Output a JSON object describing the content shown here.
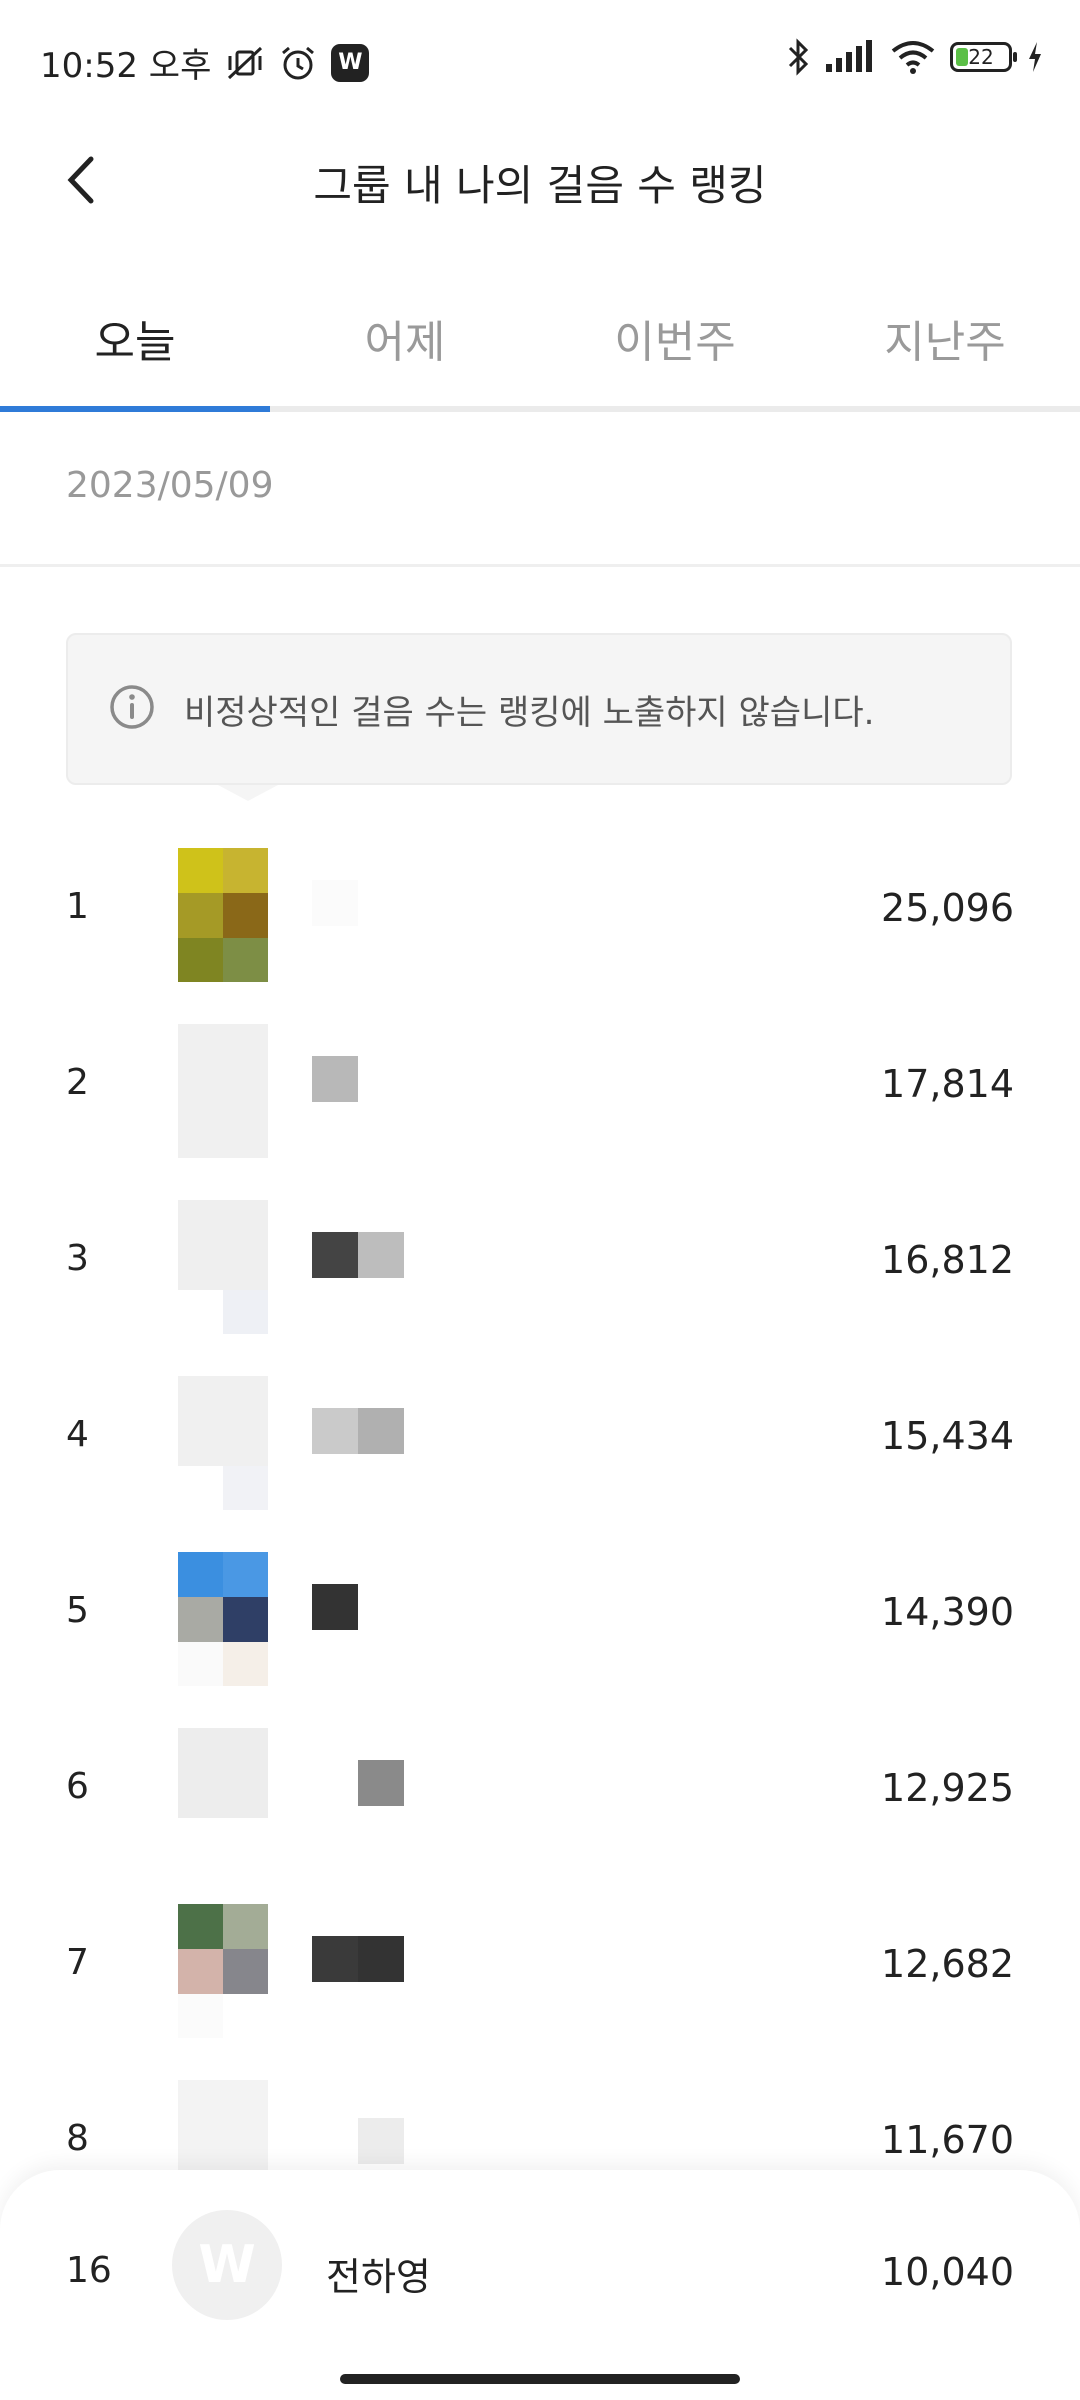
{
  "status_bar": {
    "time": "10:52 오후",
    "app_badge": "W",
    "battery": "22"
  },
  "header": {
    "title": "그룹 내 나의 걸음 수 랭킹"
  },
  "tabs": [
    {
      "label": "오늘",
      "active": true
    },
    {
      "label": "어제",
      "active": false
    },
    {
      "label": "이번주",
      "active": false
    },
    {
      "label": "지난주",
      "active": false
    }
  ],
  "date": "2023/05/09",
  "notice": {
    "text": "비정상적인 걸음 수는 랭킹에 노출하지 않습니다."
  },
  "rankings": [
    {
      "rank": "1",
      "steps": "25,096"
    },
    {
      "rank": "2",
      "steps": "17,814"
    },
    {
      "rank": "3",
      "steps": "16,812"
    },
    {
      "rank": "4",
      "steps": "15,434"
    },
    {
      "rank": "5",
      "steps": "14,390"
    },
    {
      "rank": "6",
      "steps": "12,925"
    },
    {
      "rank": "7",
      "steps": "12,682"
    },
    {
      "rank": "8",
      "steps": "11,670"
    }
  ],
  "my_rank": {
    "rank": "16",
    "avatar_letter": "W",
    "name": "전하영",
    "steps": "10,040"
  },
  "colors": {
    "accent": "#2f7bd8",
    "inactive_tab": "#9a9a9a"
  }
}
